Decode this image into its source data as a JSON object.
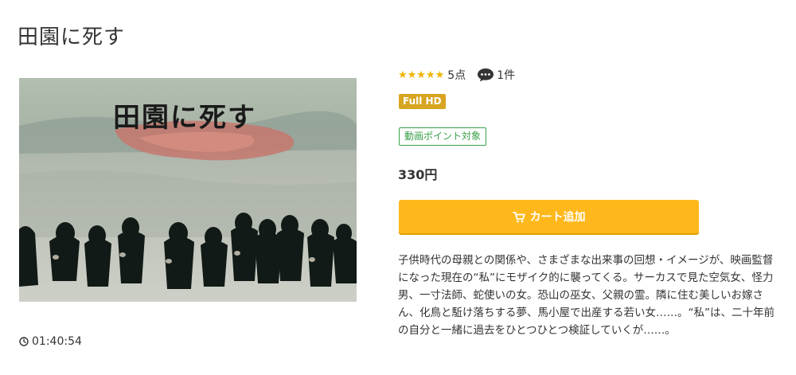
{
  "title": "田園に死す",
  "poster": {
    "overlay_title": "田園に死す"
  },
  "duration": "01:40:54",
  "rating": {
    "stars": "★★★★★",
    "score": "5点",
    "reviews": "1件"
  },
  "badges": {
    "quality": "Full HD",
    "points": "動画ポイント対象"
  },
  "price": "330円",
  "cart_button": "カート追加",
  "description": "子供時代の母親との関係や、さまざまな出来事の回想・イメージが、映画監督になった現在の“私”にモザイク的に襲ってくる。サーカスで見た空気女、怪力男、一寸法師、蛇使いの女。恐山の巫女、父親の霊。隣に住む美しいお嫁さん、化鳥と駈け落ちする夢、馬小屋で出産する若い女……。“私”は、二十年前の自分と一緒に過去をひとつひとつ検証していくが……。",
  "icons": {
    "star": "star-icon",
    "review": "speech-bubble-icon",
    "clock": "clock-icon",
    "cart": "cart-icon"
  },
  "colors": {
    "star": "#f0b400",
    "hd_badge": "#d8a521",
    "points_badge": "#3aa14a",
    "cart_button": "#ffb81c"
  }
}
